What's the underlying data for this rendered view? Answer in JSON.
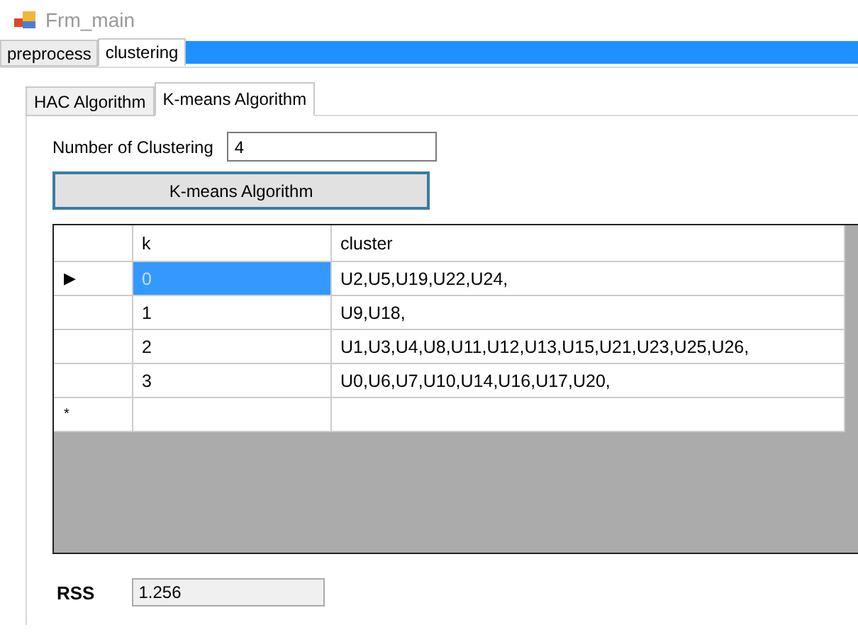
{
  "window": {
    "title": "Frm_main"
  },
  "tabs": [
    {
      "label": "preprocess",
      "selected": false
    },
    {
      "label": "clustering",
      "selected": true
    }
  ],
  "sub_tabs": [
    {
      "label": "HAC Algorithm",
      "selected": false
    },
    {
      "label": "K-means Algorithm",
      "selected": true
    }
  ],
  "cluster_count": {
    "label": "Number of Clustering",
    "value": "4"
  },
  "run_button": "K-means Algorithm",
  "table": {
    "columns": [
      "k",
      "cluster"
    ],
    "rows": [
      {
        "indicator": "▶",
        "cells": [
          "0",
          "U2,U5,U19,U22,U24,"
        ],
        "selected": true
      },
      {
        "indicator": "",
        "cells": [
          "1",
          "U9,U18,"
        ],
        "selected": false
      },
      {
        "indicator": "",
        "cells": [
          "2",
          "U1,U3,U4,U8,U11,U12,U13,U15,U21,U23,U25,U26,"
        ],
        "selected": false
      },
      {
        "indicator": "",
        "cells": [
          "3",
          "U0,U6,U7,U10,U14,U16,U17,U20,"
        ],
        "selected": false
      }
    ],
    "new_row_indicator": "*"
  },
  "rss": {
    "label": "RSS",
    "value": "1.256"
  }
}
